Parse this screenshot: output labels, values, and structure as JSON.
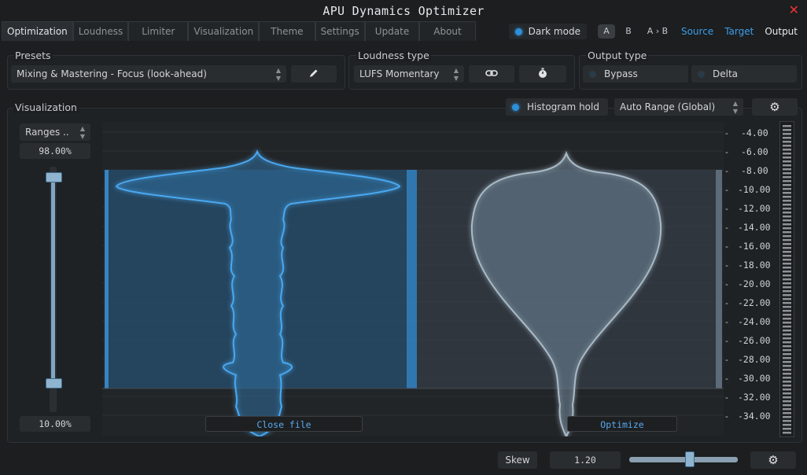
{
  "app": {
    "title": "APU Dynamics Optimizer"
  },
  "tabs": [
    {
      "label": "Optimization",
      "active": true
    },
    {
      "label": "Loudness"
    },
    {
      "label": "Limiter"
    },
    {
      "label": "Visualization"
    },
    {
      "label": "Theme"
    },
    {
      "label": "Settings"
    },
    {
      "label": "Update"
    },
    {
      "label": "About"
    }
  ],
  "header": {
    "dark_mode_label": "Dark mode",
    "a_label": "A",
    "b_label": "B",
    "ab_label": "A › B",
    "source_label": "Source",
    "target_label": "Target",
    "output_label": "Output"
  },
  "presets": {
    "label": "Presets",
    "selected": "Mixing & Mastering - Focus (look-ahead)",
    "edit_icon": "pencil-icon"
  },
  "loudness_type": {
    "label": "Loudness type",
    "selected": "LUFS Momentary",
    "link_icon": "link-icon",
    "timer_icon": "stopwatch-icon"
  },
  "output_type": {
    "label": "Output type",
    "bypass_label": "Bypass",
    "delta_label": "Delta"
  },
  "visualization": {
    "label": "Visualization",
    "histogram_hold_label": "Histogram hold",
    "range_mode": "Auto Range (Global)",
    "settings_icon": "gear-icon",
    "ranges_dropdown": "Ranges ..",
    "upper_value": "98.00%",
    "lower_value": "10.00%",
    "upper_level": 0.98,
    "lower_level": 0.1,
    "close_file_label": "Close file",
    "optimize_label": "Optimize",
    "scale_labels": [
      "-4.00",
      "-6.00",
      "-8.00",
      "-10.00",
      "-12.00",
      "-14.00",
      "-16.00",
      "-18.00",
      "-20.00",
      "-22.00",
      "-24.00",
      "-26.00",
      "-28.00",
      "-30.00",
      "-32.00",
      "-34.00"
    ]
  },
  "bottom": {
    "skew_label": "Skew",
    "skew_value": "1.20",
    "settings_icon": "gear-icon"
  },
  "colors": {
    "accent": "#2e8fd8",
    "source_blue": "#3a9ee8",
    "target_gray": "#a9b8c4",
    "close_red": "#e33333"
  }
}
